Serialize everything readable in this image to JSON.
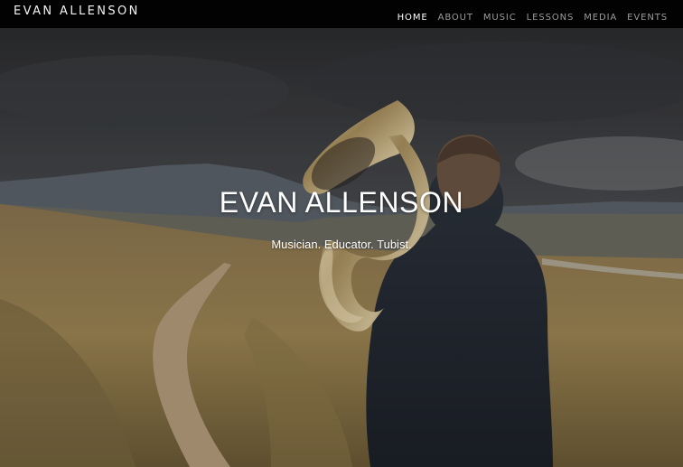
{
  "site": {
    "brand": "EVAN ALLENSON"
  },
  "nav": {
    "items": [
      "HOME",
      "ABOUT",
      "MUSIC",
      "LESSONS",
      "MEDIA",
      "EVENTS"
    ],
    "active": "HOME"
  },
  "hero": {
    "title": "EVAN ALLENSON",
    "subtitle": "Musician. Educator. Tubist."
  },
  "colors": {
    "navbar_bg": "#020202",
    "nav_active": "#ffffff",
    "nav_inactive": "#9c9c9c",
    "hero_text": "#ffffff"
  }
}
